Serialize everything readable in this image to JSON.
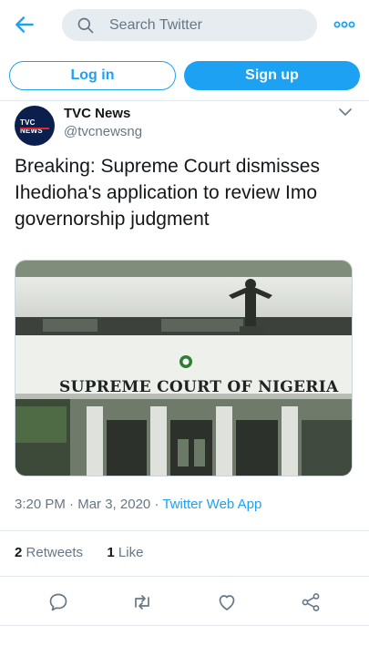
{
  "header": {
    "search_placeholder": "Search Twitter"
  },
  "auth": {
    "login_label": "Log in",
    "signup_label": "Sign up"
  },
  "tweet": {
    "user_name": "TVC News",
    "user_handle": "@tvcnewsng",
    "avatar_text": "TVC NEWS",
    "text": "Breaking: Supreme Court dismisses Ihedioha's application to review Imo governorship judgment",
    "image_sign_text": "SUPREME COURT OF NIGERIA",
    "time": "3:20 PM",
    "date": "Mar 3, 2020",
    "source_app": "Twitter Web App",
    "retweets_count": "2",
    "retweets_label": "Retweets",
    "likes_count": "1",
    "likes_label": "Like"
  },
  "icons": {
    "back": "arrow-left-icon",
    "search": "search-icon",
    "more": "more-dots-icon",
    "caret": "chevron-down-icon",
    "reply": "reply-icon",
    "retweet": "retweet-icon",
    "like": "heart-icon",
    "share": "share-icon"
  },
  "colors": {
    "accent": "#1da1f2",
    "muted": "#657786",
    "text": "#14171a"
  }
}
